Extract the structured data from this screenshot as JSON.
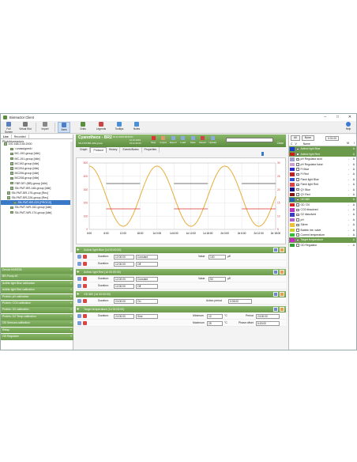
{
  "window": {
    "title": "Bioreactor Client"
  },
  "ribbon": {
    "buttons": [
      {
        "label": "Full Screen",
        "color": "#5b7fb7"
      },
      {
        "label": "Virtual Kbd",
        "color": "#777"
      },
      {
        "label": "Import",
        "color": "#888"
      },
      {
        "label": "Axes",
        "color": "#4a7ec7",
        "active": true
      },
      {
        "label": "Grids",
        "color": "#5c8c3e"
      },
      {
        "label": "Legends",
        "color": "#c44"
      },
      {
        "label": "Tooltips",
        "color": "#4a8fd6"
      },
      {
        "label": "Notes",
        "color": "#4a8fd6"
      }
    ],
    "help": "Help"
  },
  "left": {
    "tabs": [
      "Live",
      "Recorded"
    ],
    "heading": "Photobioreactors",
    "tree": [
      {
        "label": "192.168.3.54:2000",
        "indent": 1
      },
      {
        "label": "<unassigned>",
        "indent": 3
      },
      {
        "label": "MC-192-group [Idle]",
        "indent": 3
      },
      {
        "label": "MC-191-group [Idle]",
        "indent": 3
      },
      {
        "label": "MC192-group [Idle]",
        "indent": 3
      },
      {
        "label": "MC204-group [Idle]",
        "indent": 3
      },
      {
        "label": "MC206-group [Idle]",
        "indent": 3
      },
      {
        "label": "MC208-group [Idle]",
        "indent": 3
      },
      {
        "label": "FBR DFI (BB)-group [Idle]",
        "indent": 3
      },
      {
        "label": "SN-FMT-BR-148-group [Idle]",
        "indent": 3
      },
      {
        "label": "SN-FMT-BR-175-group [Rec]",
        "indent": 2
      },
      {
        "label": "SN-FMT-BR-226-group [Rec]",
        "indent": 2
      },
      {
        "label": "SN-FMT-BR-229 [PROCD]",
        "indent": 4,
        "selected": true
      },
      {
        "label": "SN-FMT-WR-152-group [Idle]",
        "indent": 3
      },
      {
        "label": "SN-FMT-WR-174-group [Idle]",
        "indent": 3
      }
    ],
    "panels": [
      "Device #449226",
      "BR-Pump #0",
      "Actinic light Blue calibration",
      "Actinic light Red calibration",
      "Probes: pH calibration",
      "Probes: CO2 calibration",
      "Probes: O2 calibration",
      "Probes: O2 Temp calibration",
      "OD Sensors calibration",
      "Relay",
      "OD Regulator"
    ]
  },
  "center": {
    "title": "Cyanothece - BR2",
    "sub1": "01.10.2019 08:30:01",
    "sub2": "12.10.2019",
    "sub3": "15:11:20.00",
    "info": "SN-FMT-BR-229-group",
    "toolbar": [
      "Stop",
      "Import",
      "Export",
      "Load",
      "Save",
      "Revert",
      "Upload"
    ],
    "close": "Close",
    "tabs": [
      "Graph",
      "Protocol",
      "History",
      "Events/Notes",
      "Properties"
    ],
    "active_tab": "Protocol"
  },
  "chart_data": {
    "type": "line",
    "x_ticks": [
      "0:00",
      "6:00",
      "12:00",
      "18:00",
      "1d 0:00",
      "1d 6:00",
      "1d 12:00",
      "1d 18:00",
      "2d 0:00",
      "2d 6:00",
      "2d 12:00",
      "2d 18:00"
    ],
    "y_ticks_left": [
      "500",
      "400",
      "300",
      "200",
      "100",
      "0"
    ],
    "y_ticks_right": [
      "30",
      "25",
      "20",
      "15",
      "10",
      "5"
    ],
    "series": [
      {
        "color": "#e7ad3a",
        "values_desc": "sinusoidal light, period 24h, range 0-500"
      },
      {
        "color": "#444",
        "values": [
          200,
          200
        ]
      },
      {
        "color": "#d33",
        "values": [
          50,
          50
        ]
      }
    ],
    "ylim": [
      0,
      500
    ]
  },
  "protocol": [
    {
      "title": "Actinic light Blue  (1d 00:00:00)",
      "duration": "12:00:00",
      "mode": "Constant",
      "value_label": "Value",
      "value": "100",
      "unit": "µE",
      "row2_duration": "12:00:00",
      "row2_mode": "Off"
    },
    {
      "title": "Actinic light Red  (1d 00:00:00)",
      "duration": "12:00:00",
      "mode": "Constant",
      "value_label": "Value",
      "value": "50",
      "unit": "µE",
      "row2_duration": "12:00:00",
      "row2_mode": "Off"
    },
    {
      "title": "OD 680  (1d 00:00:00)",
      "duration": "24:00:00",
      "mode": "On",
      "value_label": "Action period",
      "value": "0:05:00"
    },
    {
      "title": "Target temperature  (1d 00:00:00)",
      "duration": "24:00:00",
      "mode": "Sine",
      "min_label": "Minimum",
      "min": "10",
      "max_label": "Maximum",
      "max": "25",
      "unit": "°C",
      "period_label": "Period",
      "period": "24:00:00",
      "phase_label": "Phase offset",
      "phase": "6:00:00"
    }
  ],
  "right": {
    "buttons": [
      "All",
      "None"
    ],
    "time": "0:01:00",
    "header": {
      "c": "C",
      "v": "V",
      "name": "Name",
      "m": "M",
      "a": "I"
    },
    "items": [
      {
        "name": "Actinic light Blue",
        "color": "#1a3cd6",
        "m": "",
        "a": "A",
        "sel": true
      },
      {
        "name": "Actinic light Red",
        "color": "#d41a1a",
        "m": "",
        "a": "A",
        "sel": true
      },
      {
        "name": "pH Regulator acid",
        "color": "#a0a0d0",
        "m": "-",
        "a": "A"
      },
      {
        "name": "pH Regulator base",
        "color": "#d0a0d0",
        "m": "-",
        "a": "A"
      },
      {
        "name": "Ft Blue",
        "color": "#2a2ad0",
        "m": "-",
        "a": "A"
      },
      {
        "name": "Ft Red",
        "color": "#c02020",
        "m": "-",
        "a": "A"
      },
      {
        "name": "Flash light Blue",
        "color": "#3050e0",
        "m": "-",
        "a": "A"
      },
      {
        "name": "Flash light Red",
        "color": "#e04040",
        "m": "-",
        "a": "A"
      },
      {
        "name": "QY Blue",
        "color": "#101090",
        "m": "-",
        "a": "A"
      },
      {
        "name": "QY Red",
        "color": "#901010",
        "m": "-",
        "a": "A"
      },
      {
        "name": "OD 680",
        "color": "#2060c0",
        "m": "",
        "a": "A",
        "sel": true
      },
      {
        "name": "OD 720",
        "color": "#e02020",
        "m": "-",
        "a": "A"
      },
      {
        "name": "CO2 dissolved",
        "color": "#c030c0",
        "m": "-",
        "a": "A"
      },
      {
        "name": "O2 dissolved",
        "color": "#3a3ac8",
        "m": "-",
        "a": "A"
      },
      {
        "name": "pH",
        "color": "#b060d0",
        "m": "-",
        "a": "A"
      },
      {
        "name": "Stirrer",
        "color": "#f0c030",
        "m": "-",
        "a": "A"
      },
      {
        "name": "Bubble intr. valve",
        "color": "#d0d020",
        "m": "-",
        "a": "A"
      },
      {
        "name": "Current temperature",
        "color": "#30c030",
        "m": "-",
        "a": "A"
      },
      {
        "name": "Target temperature",
        "color": "#d020d0",
        "m": "",
        "a": "A",
        "sel": true
      },
      {
        "name": "OD Regulator",
        "color": "#30a030",
        "m": "-",
        "a": "A"
      }
    ]
  }
}
